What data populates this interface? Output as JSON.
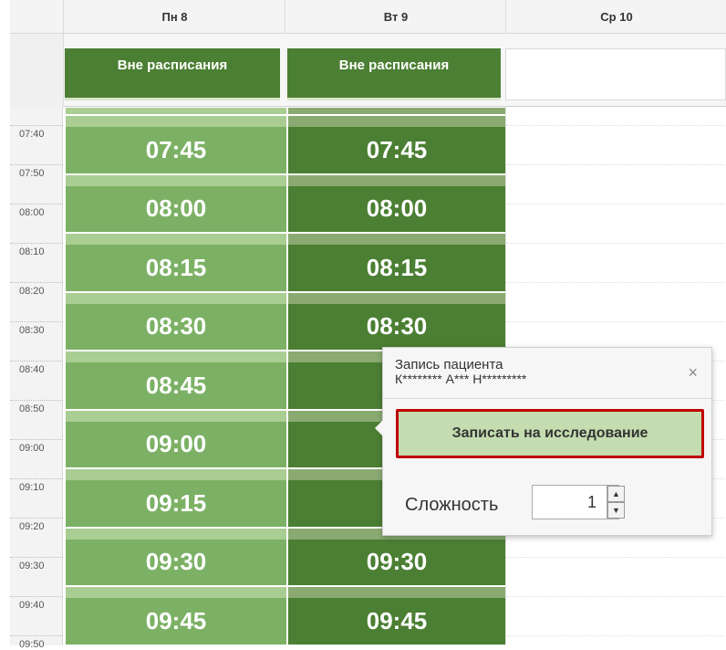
{
  "columns": {
    "monday": "Пн 8",
    "tuesday": "Вт 9",
    "wednesday": "Ср 10"
  },
  "all_day": {
    "monday": "Вне расписания",
    "tuesday": "Вне расписания"
  },
  "time_labels": [
    "07:40",
    "07:50",
    "08:00",
    "08:10",
    "08:20",
    "08:30",
    "08:40",
    "08:50",
    "09:00",
    "09:10",
    "09:20",
    "09:30",
    "09:40",
    "09:50"
  ],
  "slots": {
    "monday": [
      "07:45",
      "08:00",
      "08:15",
      "08:30",
      "08:45",
      "09:00",
      "09:15",
      "09:30",
      "09:45"
    ],
    "tuesday": [
      "07:45",
      "08:00",
      "08:15",
      "08:30",
      "08",
      "09",
      "09",
      "09:30",
      "09:45"
    ]
  },
  "popup": {
    "title": "Запись пациента",
    "patient": "К******** А*** Н*********",
    "close": "×",
    "record_button": "Записать на исследование",
    "complexity_label": "Сложность",
    "complexity_value": "1",
    "spin_up": "▲",
    "spin_down": "▼"
  },
  "colors": {
    "monday_slot": "#7cb165",
    "tuesday_slot": "#4b7f33",
    "button_border": "#c00000"
  }
}
